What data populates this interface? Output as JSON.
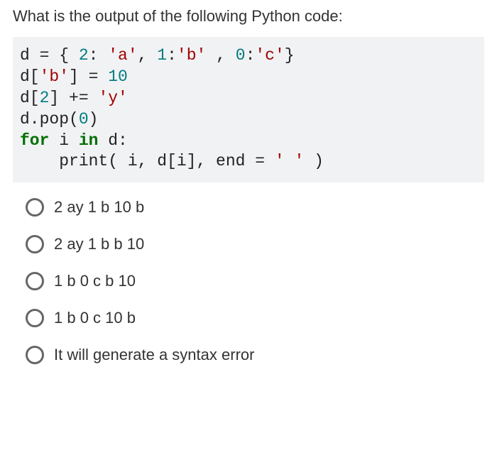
{
  "question": "What is the output of the following Python code:",
  "code": {
    "line1_a": "d = { ",
    "line1_num1": "2",
    "line1_b": ": ",
    "line1_str1": "'a'",
    "line1_c": ", ",
    "line1_num2": "1",
    "line1_d": ":",
    "line1_str2": "'b'",
    "line1_e": " , ",
    "line1_num3": "0",
    "line1_f": ":",
    "line1_str3": "'c'",
    "line1_g": "}",
    "line2_a": "d[",
    "line2_str": "'b'",
    "line2_b": "] = ",
    "line2_num": "10",
    "line3_a": "d[",
    "line3_num": "2",
    "line3_b": "] += ",
    "line3_str": "'y'",
    "line4_a": "d.pop(",
    "line4_num": "0",
    "line4_b": ")",
    "line5_kw1": "for",
    "line5_a": " i ",
    "line5_kw2": "in",
    "line5_b": " d:",
    "line6_a": "    print( i, d[i], end = ",
    "line6_str": "' '",
    "line6_b": " )"
  },
  "options": [
    {
      "label": "2 ay 1 b 10 b"
    },
    {
      "label": "2 ay 1 b b 10"
    },
    {
      "label": "1 b 0 c b 10"
    },
    {
      "label": "1 b 0 c 10 b"
    },
    {
      "label": "It will generate a syntax error"
    }
  ]
}
